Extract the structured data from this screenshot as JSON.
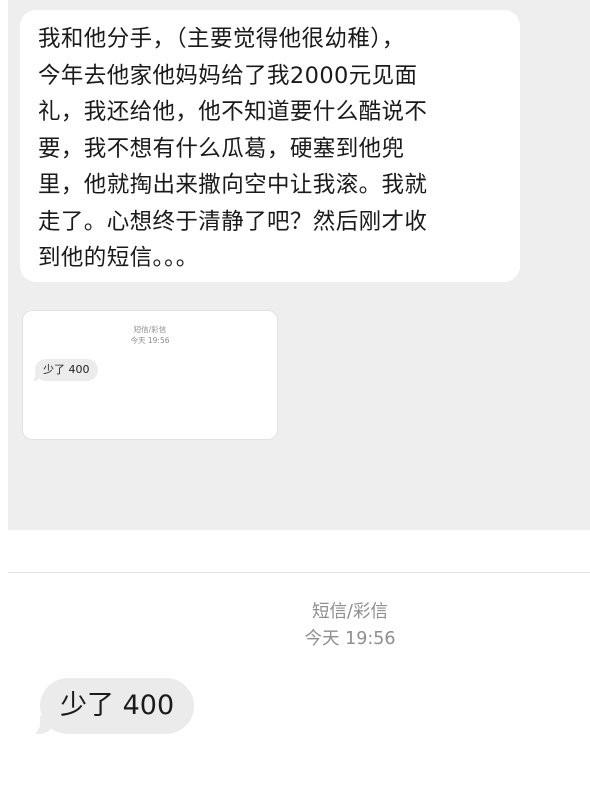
{
  "post": {
    "message_lines": [
      "我和他分手，（主要觉得他很幼稚），",
      "今年去他家他妈妈给了我2000元见面",
      "礼，我还给他，他不知道要什么酷说不",
      "要，我不想有什么瓜葛，硬塞到他兜",
      "里，他就掏出来撒向空中让我滚。我就",
      "走了。心想终于清静了吧？然后刚才收",
      "到他的短信。。。"
    ]
  },
  "thumbnail": {
    "sender": "短信/彩信",
    "time": "今天 19:56",
    "message": "少了 400"
  },
  "sms": {
    "sender": "短信/彩信",
    "time": "今天 19:56",
    "message": "少了 400"
  },
  "colors": {
    "chat_background": "#eeeeef",
    "bubble_white": "#ffffff",
    "incoming_bubble": "#ebebeb",
    "meta_gray": "#8e8e93"
  }
}
